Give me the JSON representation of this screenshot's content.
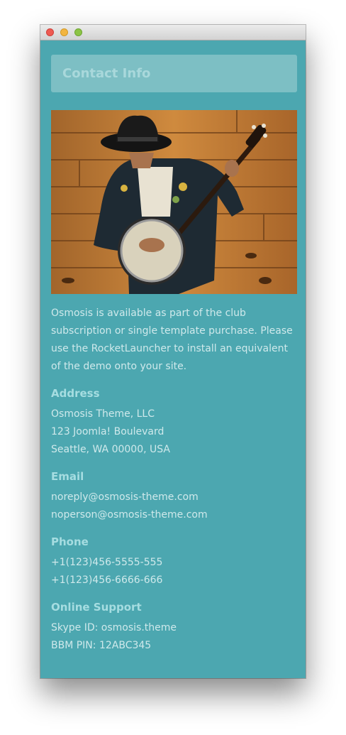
{
  "window": {
    "controls": [
      "close",
      "minimize",
      "zoom"
    ]
  },
  "header": {
    "title": "Contact Info"
  },
  "image": {
    "alt": "Banjo player"
  },
  "intro": "Osmosis is available as part of the club subscription or single template purchase. Please use the RocketLauncher to install an equivalent of the demo onto your site.",
  "sections": {
    "address": {
      "title": "Address",
      "lines": [
        "Osmosis Theme, LLC",
        "123 Joomla! Boulevard",
        "Seattle, WA 00000, USA"
      ]
    },
    "email": {
      "title": "Email",
      "lines": [
        "noreply@osmosis-theme.com",
        "noperson@osmosis-theme.com"
      ]
    },
    "phone": {
      "title": "Phone",
      "lines": [
        "+1(123)456-5555-555",
        "+1(123)456-6666-666"
      ]
    },
    "support": {
      "title": "Online Support",
      "lines": [
        "Skype ID: osmosis.theme",
        "BBM PIN: 12ABC345"
      ]
    }
  },
  "colors": {
    "background": "#4ca7b0",
    "header_box": "#7dbfc4",
    "heading_text": "#a6dde1",
    "body_text": "#cfe9eb"
  }
}
